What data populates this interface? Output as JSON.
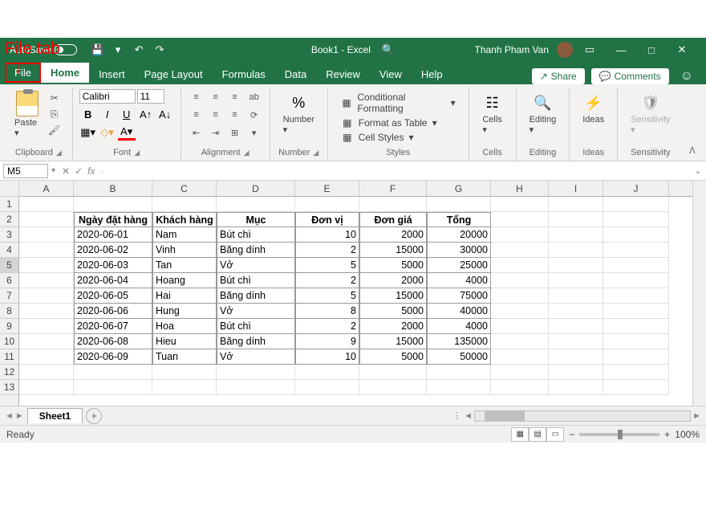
{
  "annotation": {
    "label": "File tab",
    "arrow": "↓"
  },
  "titlebar": {
    "autosave_label": "AutoSave",
    "doc_title": "Book1  -  Excel",
    "user_name": "Thanh Pham Van"
  },
  "tabs": {
    "file": "File",
    "items": [
      "Home",
      "Insert",
      "Page Layout",
      "Formulas",
      "Data",
      "Review",
      "View",
      "Help"
    ],
    "share": "Share",
    "comments": "Comments"
  },
  "ribbon": {
    "clipboard": {
      "label": "Clipboard",
      "paste": "Paste"
    },
    "font": {
      "label": "Font",
      "name": "Calibri",
      "size": "11"
    },
    "alignment": {
      "label": "Alignment"
    },
    "number": {
      "label": "Number",
      "btn": "Number"
    },
    "styles": {
      "label": "Styles",
      "cond_fmt": "Conditional Formatting",
      "fmt_table": "Format as Table",
      "cell_styles": "Cell Styles"
    },
    "cells": {
      "label": "Cells",
      "btn": "Cells"
    },
    "editing": {
      "label": "Editing",
      "btn": "Editing"
    },
    "ideas": {
      "label": "Ideas",
      "btn": "Ideas"
    },
    "sensitivity": {
      "label": "Sensitivity",
      "btn": "Sensitivity"
    }
  },
  "namebox": {
    "value": "M5",
    "fx": "fx"
  },
  "columns": [
    "A",
    "B",
    "C",
    "D",
    "E",
    "F",
    "G",
    "H",
    "I",
    "J"
  ],
  "rows": [
    "1",
    "2",
    "3",
    "4",
    "5",
    "6",
    "7",
    "8",
    "9",
    "10",
    "11",
    "12",
    "13"
  ],
  "table": {
    "headers": [
      "Ngày đặt hàng",
      "Khách hàng",
      "Mục",
      "Đơn vị",
      "Đơn giá",
      "Tổng"
    ],
    "data": [
      [
        "2020-06-01",
        "Nam",
        "Bút chì",
        "10",
        "2000",
        "20000"
      ],
      [
        "2020-06-02",
        "Vinh",
        "Băng dính",
        "2",
        "15000",
        "30000"
      ],
      [
        "2020-06-03",
        "Tan",
        "Vở",
        "5",
        "5000",
        "25000"
      ],
      [
        "2020-06-04",
        "Hoang",
        "Bút chì",
        "2",
        "2000",
        "4000"
      ],
      [
        "2020-06-05",
        "Hai",
        "Băng dính",
        "5",
        "15000",
        "75000"
      ],
      [
        "2020-06-06",
        "Hung",
        "Vở",
        "8",
        "5000",
        "40000"
      ],
      [
        "2020-06-07",
        "Hoa",
        "Bút chì",
        "2",
        "2000",
        "4000"
      ],
      [
        "2020-06-08",
        "Hieu",
        "Băng dính",
        "9",
        "15000",
        "135000"
      ],
      [
        "2020-06-09",
        "Tuan",
        "Vở",
        "10",
        "5000",
        "50000"
      ]
    ]
  },
  "sheet": {
    "name": "Sheet1"
  },
  "statusbar": {
    "ready": "Ready",
    "zoom": "100%"
  }
}
